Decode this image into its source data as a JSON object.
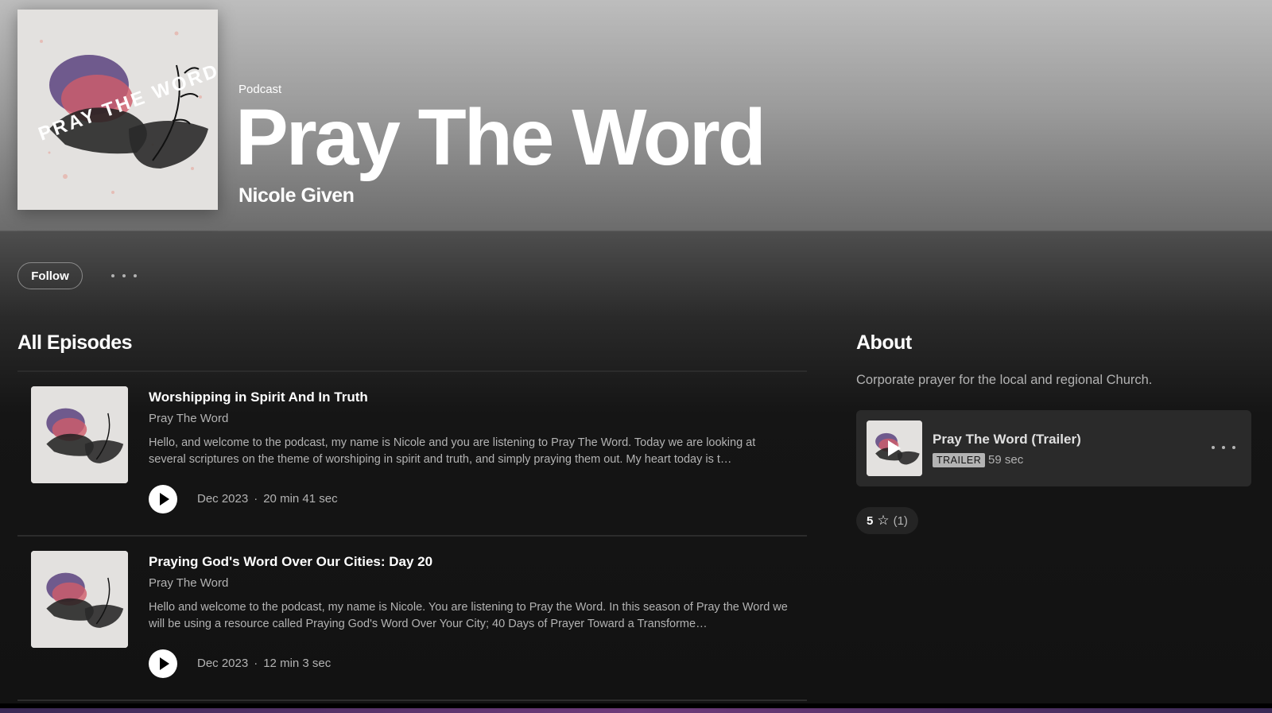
{
  "header": {
    "type_label": "Podcast",
    "title": "Pray The Word",
    "author": "Nicole Given",
    "cover_text": "PRAY THE WORD"
  },
  "actions": {
    "follow_label": "Follow",
    "more_icon": "more-horizontal-icon"
  },
  "episodes_section": {
    "title": "All Episodes",
    "items": [
      {
        "title": "Worshipping in Spirit And In Truth",
        "show": "Pray The Word",
        "description": "Hello, and welcome to the podcast, my name is Nicole and you are listening to Pray The Word.  Today we are looking at several scriptures on the theme of worshiping in spirit and truth, and simply praying them out.   My heart today is t…",
        "date": "Dec 2023",
        "separator": "·",
        "duration": "20 min 41 sec"
      },
      {
        "title": "Praying God's Word Over Our Cities: Day 20",
        "show": "Pray The Word",
        "description": "Hello and welcome to the podcast, my name is Nicole. You are listening to Pray the Word. In this season of Pray the Word we will be using a resource called Praying God's Word Over Your City; 40 Days of Prayer Toward a Transforme…",
        "date": "Dec 2023",
        "separator": "·",
        "duration": "12 min 3 sec"
      }
    ]
  },
  "about": {
    "title": "About",
    "description": "Corporate prayer for the local and regional Church.",
    "trailer": {
      "title": "Pray The Word (Trailer)",
      "badge": "TRAILER",
      "duration": "59 sec"
    },
    "rating": {
      "value": "5",
      "count": "(1)"
    }
  },
  "colors": {
    "header_top": "#bdbdbd",
    "background": "#121212",
    "card": "#2a2a2a",
    "muted_text": "#b3b3b3"
  }
}
